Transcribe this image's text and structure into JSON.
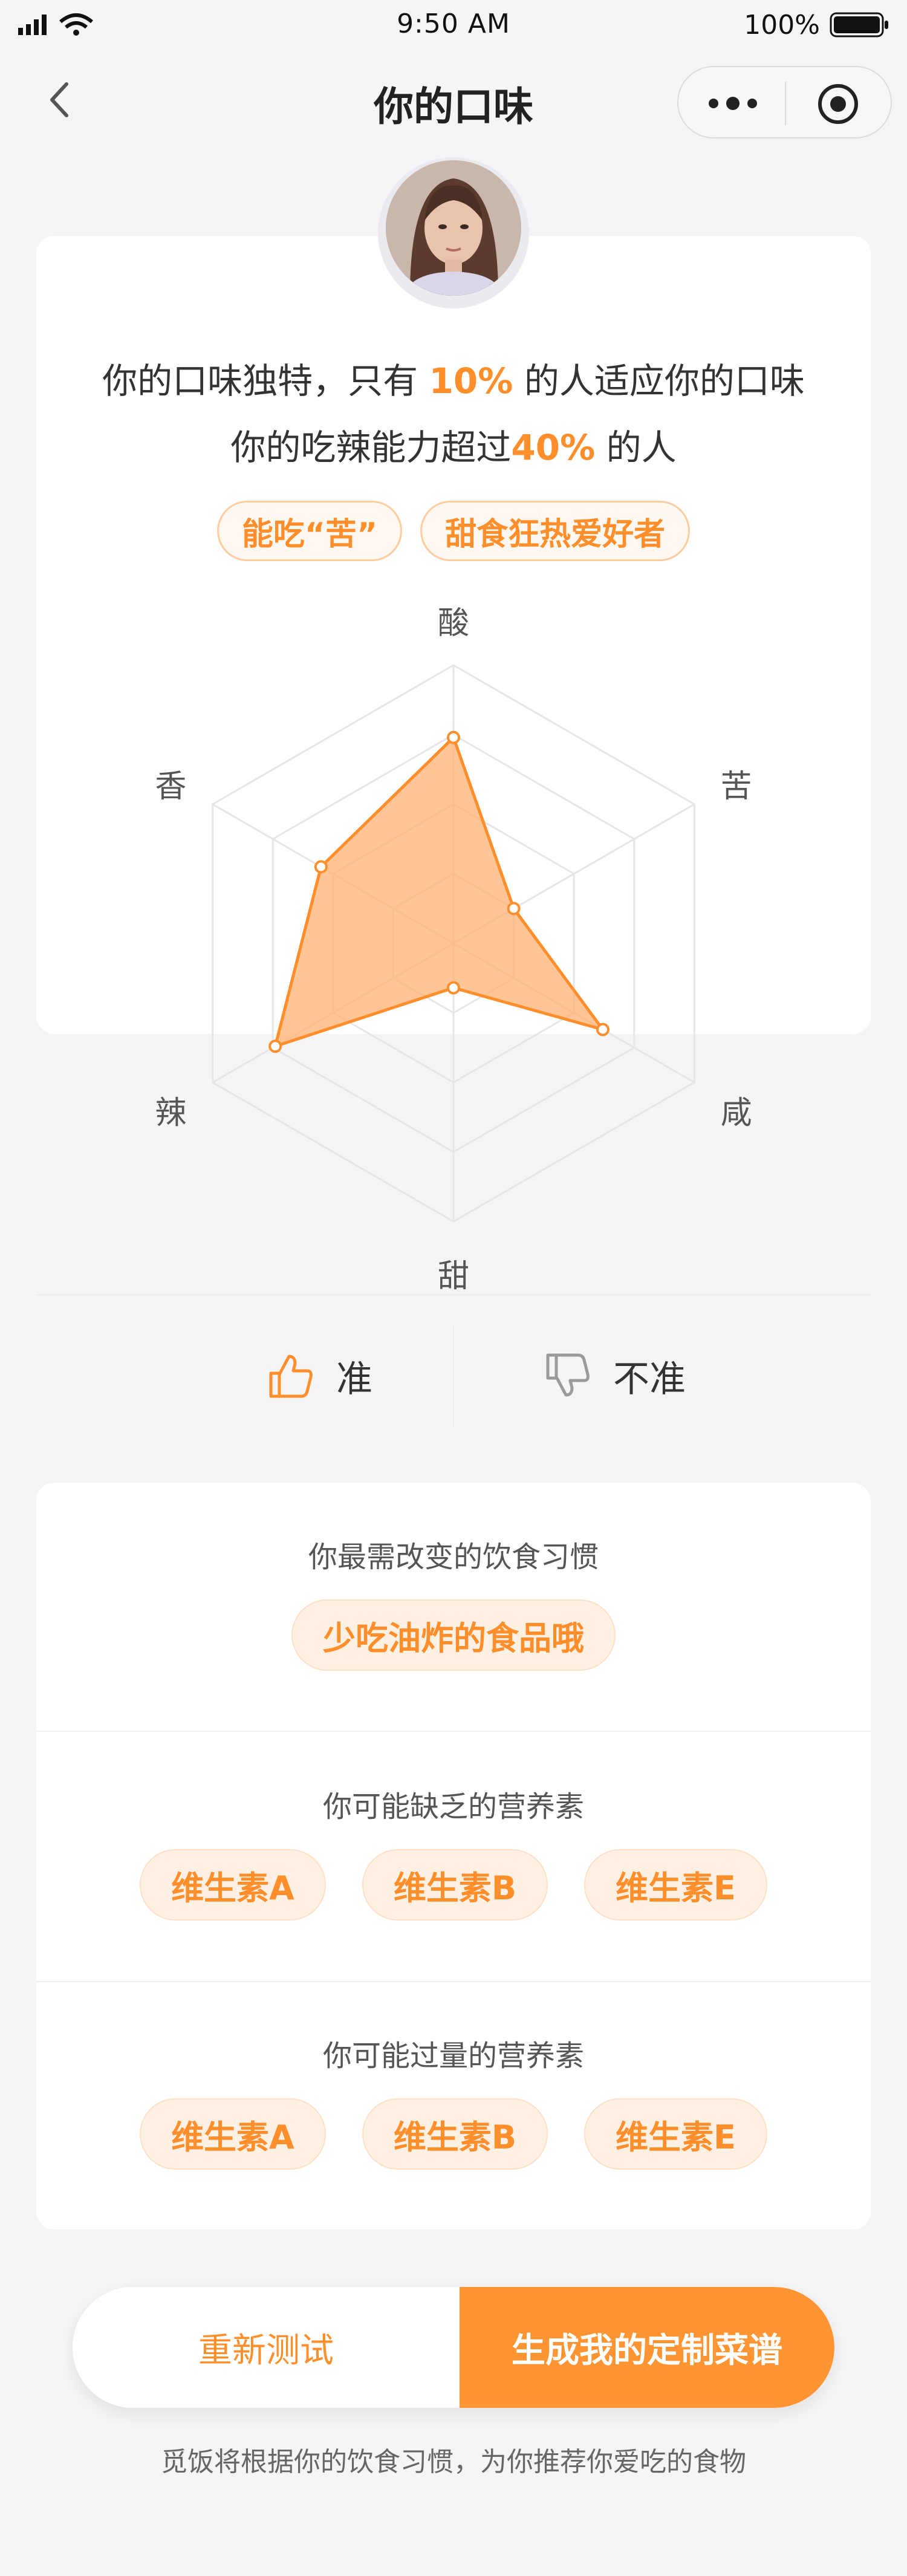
{
  "status_bar": {
    "time": "9:50 AM",
    "battery": "100%"
  },
  "nav": {
    "title": "你的口味"
  },
  "summary": {
    "line1_prefix": "你的口味独特，只有 ",
    "line1_highlight": "10%",
    "line1_suffix": " 的人适应你的口味",
    "line2_prefix": "你的吃辣能力超过",
    "line2_highlight": "40%",
    "line2_suffix": " 的人",
    "tags": [
      "能吃“苦”",
      "甜食狂热爱好者"
    ]
  },
  "chart_data": {
    "type": "radar",
    "axes": [
      "酸",
      "苦",
      "咸",
      "甜",
      "辣",
      "香"
    ],
    "values": [
      0.74,
      0.25,
      0.62,
      0.16,
      0.74,
      0.55
    ],
    "scale_max": 1,
    "rings": 4,
    "color": "#ff8e2b",
    "fill": "#ffb273"
  },
  "feedback": {
    "accurate": "准",
    "inaccurate": "不准"
  },
  "habits": {
    "title": "你最需改变的饮食习惯",
    "tag": "少吃油炸的食品哦"
  },
  "lacking": {
    "title": "你可能缺乏的营养素",
    "items": [
      "维生素A",
      "维生素B",
      "维生素E"
    ]
  },
  "excess": {
    "title": "你可能过量的营养素",
    "items": [
      "维生素A",
      "维生素B",
      "维生素E"
    ]
  },
  "actions": {
    "retry": "重新测试",
    "generate": "生成我的定制菜谱",
    "footnote": "觅饭将根据你的饮食习惯，为你推荐你爱吃的食物"
  },
  "colors": {
    "accent": "#ff8e2b",
    "background": "#f5f5f7"
  }
}
